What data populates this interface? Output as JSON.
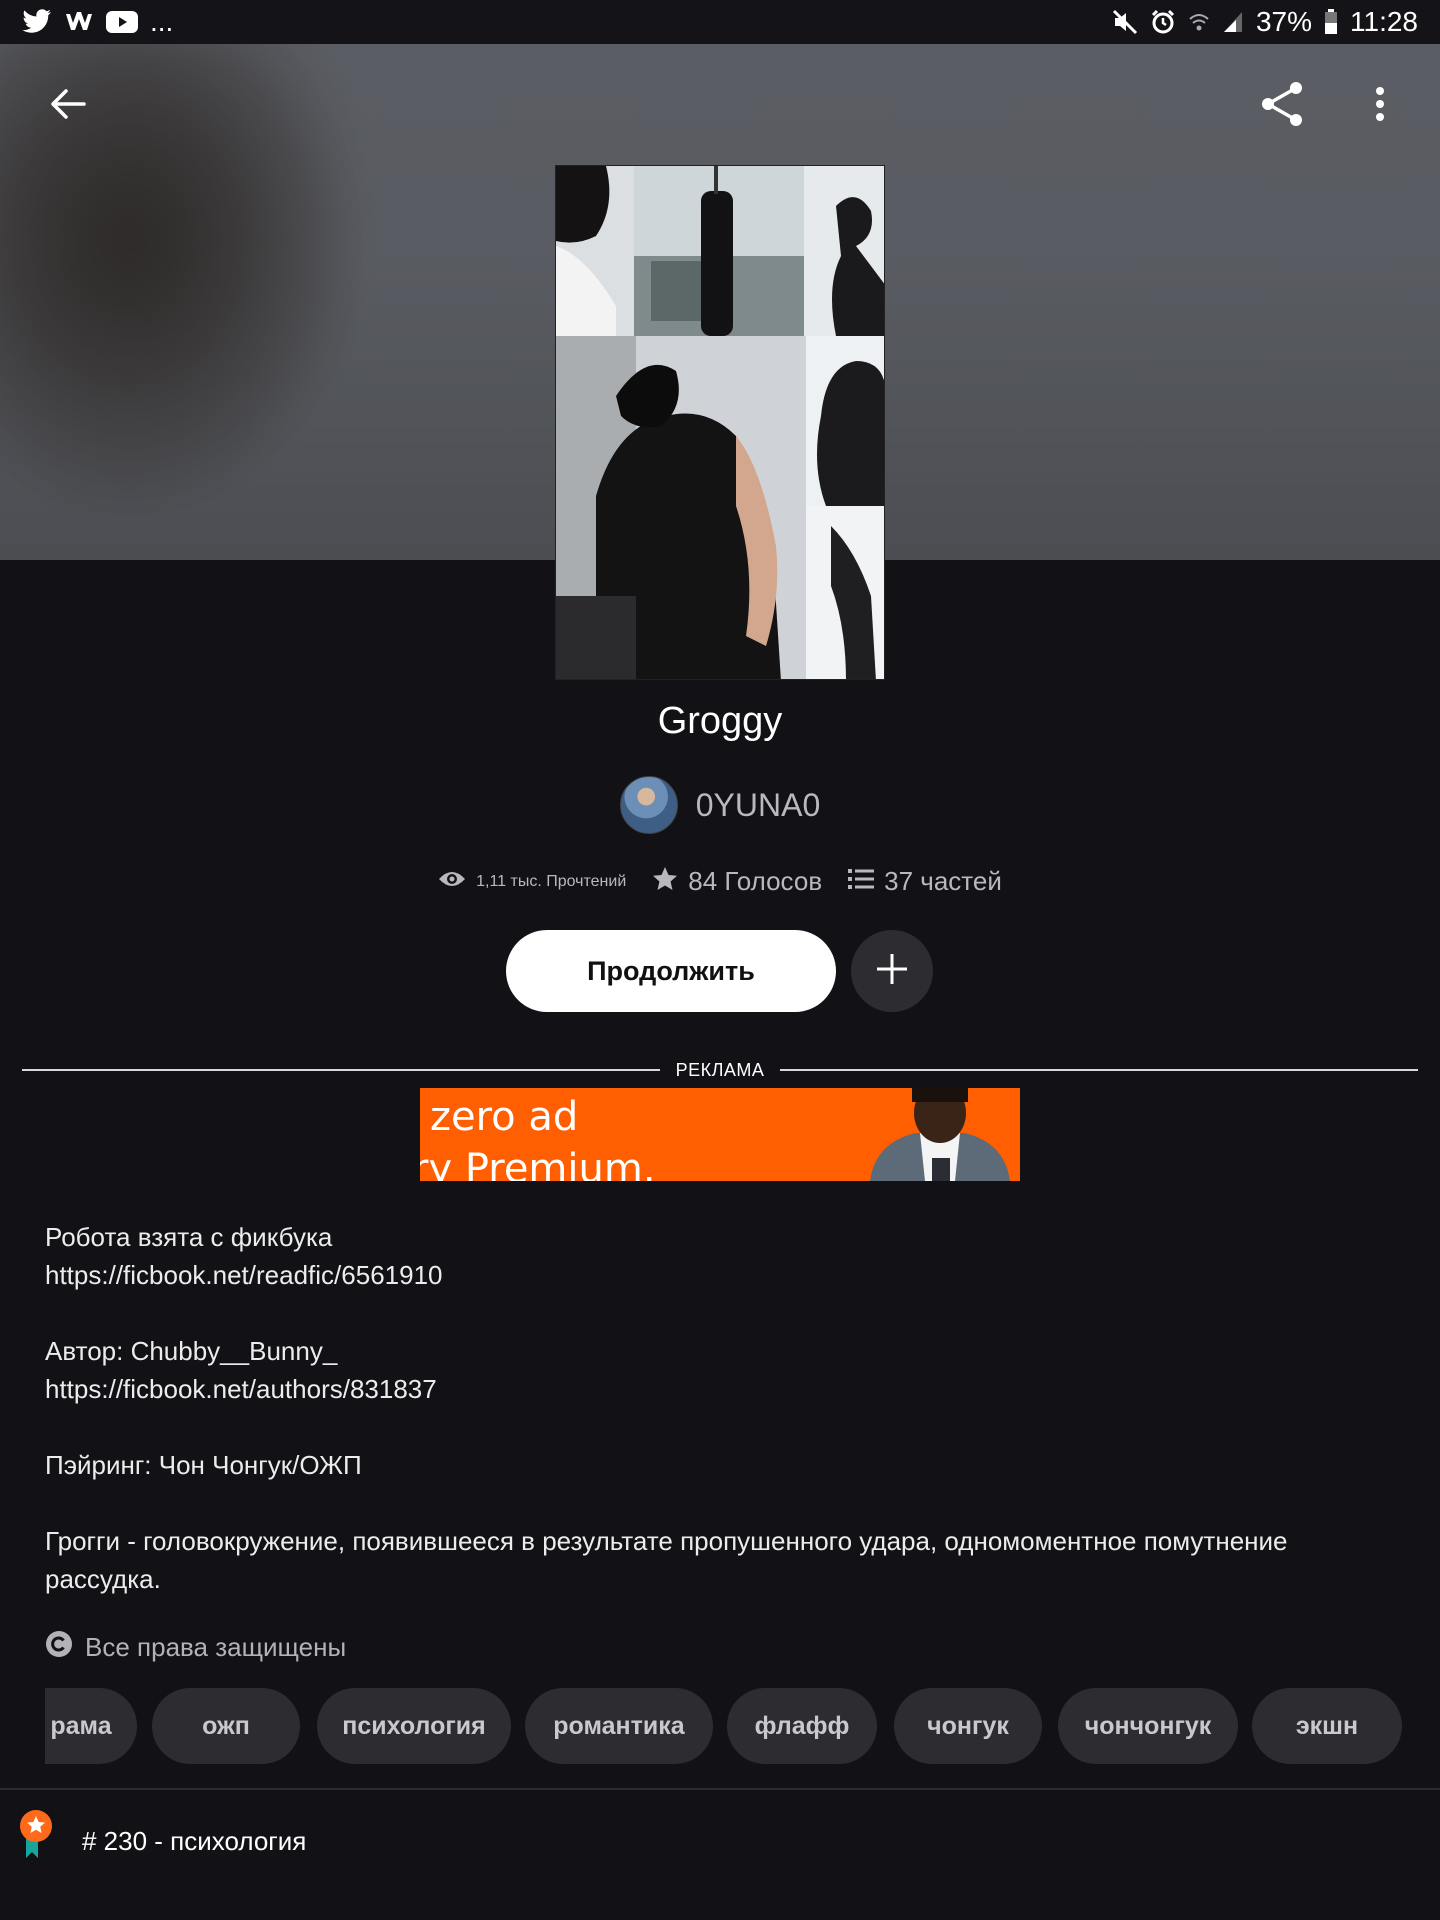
{
  "status_bar": {
    "left_icons": [
      "twitter-icon",
      "wattpad-icon",
      "youtube-icon"
    ],
    "overflow": "...",
    "battery_percent": "37%",
    "time": "11:28"
  },
  "header": {
    "back_icon": "arrow-left-icon",
    "share_icon": "share-icon",
    "menu_icon": "more-vertical-icon"
  },
  "story": {
    "title": "Groggy",
    "author": "0YUNA0",
    "reads": "1,11 тыс. Прочтений",
    "votes": "84 Голосов",
    "parts": "37 частей",
    "continue_label": "Продолжить"
  },
  "ad": {
    "label": "РЕКЛАМА",
    "line1": "zero ad",
    "line2": "ry Premium."
  },
  "description": "Робота взята с фикбука\nhttps://ficbook.net/readfic/6561910\n\nАвтор: Chubby__Bunny_\nhttps://ficbook.net/authors/831837\n\nПэйринг: Чон Чонгук/ОЖП\n\nГрогги - головокружение, появившееся в результате пропушенного удара, одномоментное помутнение\nрассудка.",
  "copyright": "Все права защищены",
  "tags": [
    "рама",
    "ожп",
    "психология",
    "романтика",
    "флафф",
    "чонгук",
    "чончонгук",
    "экшн"
  ],
  "ranking": "# 230 - психология",
  "colors": {
    "background": "#121115",
    "accent_orange": "#ff5f00",
    "tag_bg": "#2c2c31"
  }
}
